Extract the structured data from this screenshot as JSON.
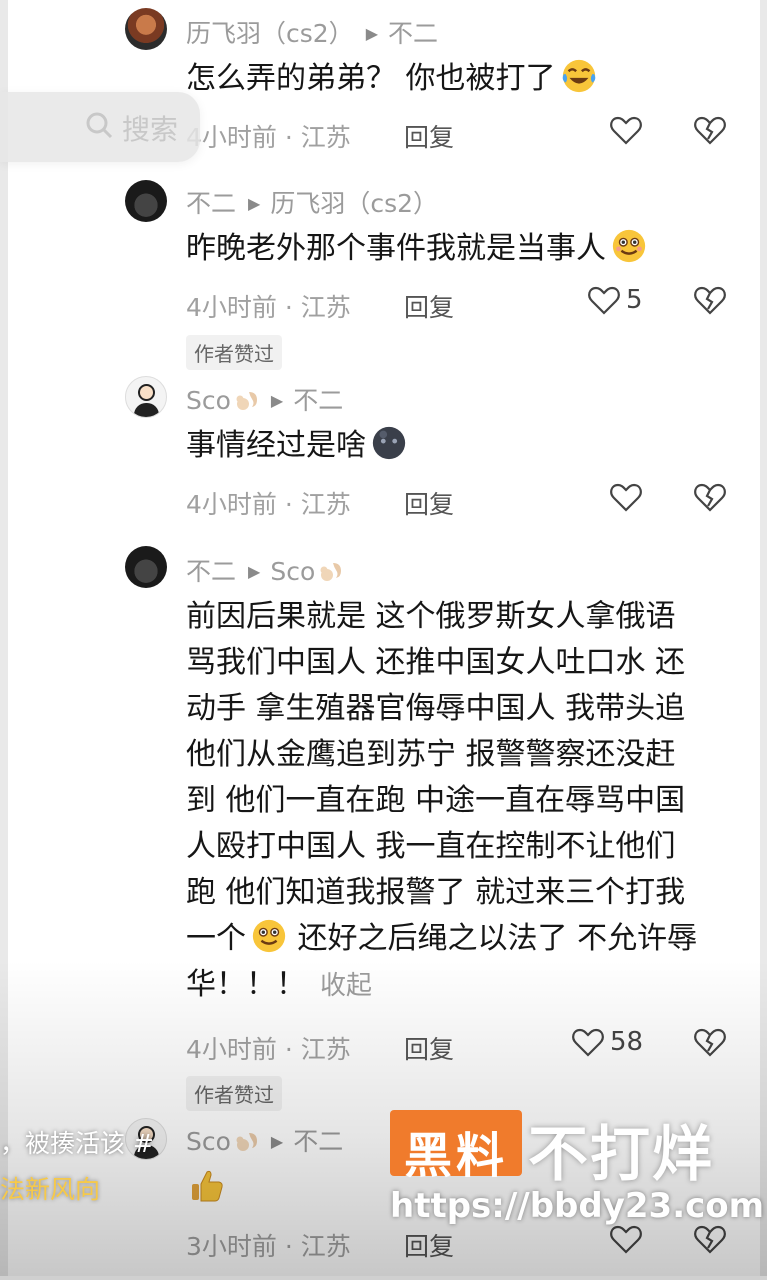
{
  "search": {
    "label": "搜索"
  },
  "comments": [
    {
      "author": "历飞羽（cs2）",
      "reply_to": "不二",
      "text": "怎么弄的弟弟？ 你也被打了",
      "emoji": "laugh-cry-emoji",
      "location_time": "4小时前 · 江苏",
      "reply_label": "回复",
      "likes": "",
      "author_liked": ""
    },
    {
      "author": "不二",
      "reply_to": "历飞羽（cs2）",
      "text": "昨晚老外那个事件我就是当事人",
      "emoji": "smile-emoji",
      "location_time": "4小时前 · 江苏",
      "reply_label": "回复",
      "likes": "5",
      "author_liked": "作者赞过"
    },
    {
      "author": "Sco",
      "reply_to": "不二",
      "text": "事情经过是啥",
      "emoji": "dark-face-emoji",
      "location_time": "4小时前 · 江苏",
      "reply_label": "回复",
      "likes": "",
      "author_liked": ""
    },
    {
      "author": "不二",
      "reply_to": "Sco",
      "lines": [
        "前因后果就是 这个俄罗斯女人拿俄语",
        "骂我们中国人 还推中国女人吐口水 还",
        "动手 拿生殖器官侮辱中国人 我带头追",
        "他们从金鹰追到苏宁 报警警察还没赶",
        "到 他们一直在跑 中途一直在辱骂中国",
        "人殴打中国人 我一直在控制不让他们",
        "跑 他们知道我报警了 就过来三个打我"
      ],
      "line8_a": "一个",
      "line8_b": " 还好之后绳之以法了 不允许辱",
      "line9": "华！！！",
      "collapse_label": "收起",
      "location_time": "4小时前 · 江苏",
      "reply_label": "回复",
      "likes": "58",
      "author_liked": "作者赞过"
    },
    {
      "author": "Sco",
      "reply_to": "不二",
      "text": "",
      "emoji": "thumbs-up-emoji",
      "location_time": "3小时前 · 江苏",
      "reply_label": "回复",
      "likes": "",
      "author_liked": ""
    }
  ],
  "side_caption": {
    "line1": "，被揍活该 #",
    "line2": "法新风向"
  },
  "watermark": {
    "badge": "黑料",
    "title": "不打烊",
    "url": "https://bbdy23.com",
    "badge_color": "#f07b2c"
  },
  "colors": {
    "meta_gray": "#9b9b9b",
    "text": "#161616"
  }
}
